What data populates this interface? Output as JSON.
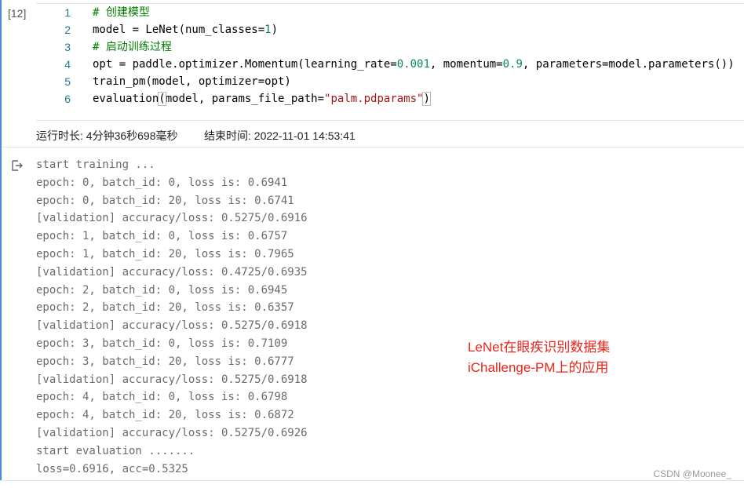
{
  "cell": {
    "exec_count": "[12]",
    "code_lines": [
      {
        "no": "1",
        "parts": [
          {
            "t": "# 创建模型",
            "c": "cm"
          }
        ]
      },
      {
        "no": "2",
        "parts": [
          {
            "t": "model = LeNet(num_classes=",
            "c": ""
          },
          {
            "t": "1",
            "c": "num"
          },
          {
            "t": ")",
            "c": ""
          }
        ]
      },
      {
        "no": "3",
        "parts": [
          {
            "t": "# 启动训练过程",
            "c": "cm"
          }
        ]
      },
      {
        "no": "4",
        "parts": [
          {
            "t": "opt = paddle.optimizer.Momentum(learning_rate=",
            "c": ""
          },
          {
            "t": "0.001",
            "c": "num"
          },
          {
            "t": ", momentum=",
            "c": ""
          },
          {
            "t": "0.9",
            "c": "num"
          },
          {
            "t": ", parameters=model.parameters())",
            "c": ""
          }
        ]
      },
      {
        "no": "5",
        "parts": [
          {
            "t": "train_pm(model, optimizer=opt)",
            "c": ""
          }
        ]
      },
      {
        "no": "6",
        "parts": [
          {
            "t": "evaluation",
            "c": ""
          },
          {
            "t": "(",
            "c": "hl"
          },
          {
            "t": "model, params_file_path=",
            "c": ""
          },
          {
            "t": "\"palm.pdparams\"",
            "c": "str"
          },
          {
            "t": ")",
            "c": "hl"
          }
        ]
      }
    ],
    "runtime": "运行时长: 4分钟36秒698毫秒",
    "end_time": "结束时间: 2022-11-01 14:53:41",
    "output_icon": "output-arrow-icon",
    "output_lines": [
      "start training ...",
      "epoch: 0, batch_id: 0, loss is: 0.6941",
      "epoch: 0, batch_id: 20, loss is: 0.6741",
      "[validation] accuracy/loss: 0.5275/0.6916",
      "epoch: 1, batch_id: 0, loss is: 0.6757",
      "epoch: 1, batch_id: 20, loss is: 0.7965",
      "[validation] accuracy/loss: 0.4725/0.6935",
      "epoch: 2, batch_id: 0, loss is: 0.6945",
      "epoch: 2, batch_id: 20, loss is: 0.6357",
      "[validation] accuracy/loss: 0.5275/0.6918",
      "epoch: 3, batch_id: 0, loss is: 0.7109",
      "epoch: 3, batch_id: 20, loss is: 0.6777",
      "[validation] accuracy/loss: 0.5275/0.6918",
      "epoch: 4, batch_id: 0, loss is: 0.6798",
      "epoch: 4, batch_id: 20, loss is: 0.6872",
      "[validation] accuracy/loss: 0.5275/0.6926",
      "start evaluation .......",
      "loss=0.6916, acc=0.5325"
    ]
  },
  "annotation": {
    "line1": "LeNet在眼疾识别数据集",
    "line2": "iChallenge-PM上的应用",
    "color": "#e8251b"
  },
  "watermark": "CSDN @Moonee_",
  "colors": {
    "cell_border": "#4a8fd6",
    "line_number": "#237893",
    "comment": "#008000",
    "number": "#098658",
    "string": "#a31515",
    "output_text": "#6b6b6b"
  }
}
